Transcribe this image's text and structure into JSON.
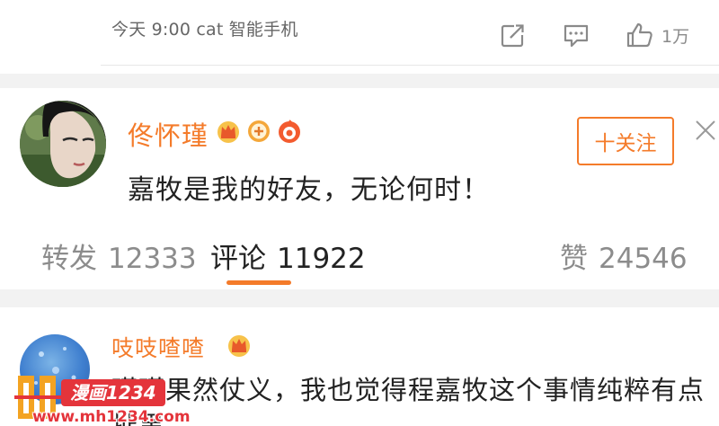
{
  "prev_post": {
    "meta": "今天 9:00 cat 智能手机",
    "like_count": "1万",
    "icons": [
      "share-icon",
      "comment-icon",
      "like-icon"
    ]
  },
  "post": {
    "author": "佟怀瑾",
    "badges": [
      "crown-badge-icon",
      "medal-badge-icon",
      "fan-badge-icon"
    ],
    "text": "嘉牧是我的好友，无论何时！",
    "follow_label": "十关注",
    "close_icon": "close-icon"
  },
  "tabs": {
    "repost": {
      "label": "转发",
      "count": "12333"
    },
    "comment": {
      "label": "评论",
      "count": "11922"
    },
    "like": {
      "label": "赞",
      "count": "24546"
    }
  },
  "comment": {
    "author": "吱吱喳喳",
    "badge": "crown-badge-icon",
    "text": "瑾瑾果然仗义，我也觉得程嘉牧这个事情纯粹有点扯黑"
  },
  "watermark": {
    "tag": "漫画1234",
    "url": "www.mh1234.com"
  },
  "colors": {
    "accent": "#f47b2a",
    "text": "#222222",
    "muted": "#8c8c8c",
    "separator": "#f2f2f2",
    "watermark_red": "#e4343b"
  }
}
